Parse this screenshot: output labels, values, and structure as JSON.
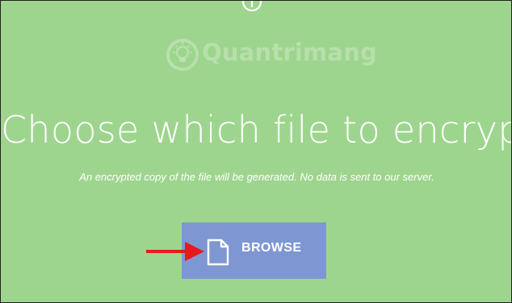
{
  "header": {
    "icon": "info-icon"
  },
  "watermark": {
    "logo_icon": "lightbulb-icon",
    "text": "Quantrimang"
  },
  "main": {
    "title": "Choose which file to encrypt",
    "subtitle": "An encrypted copy of the file will be generated. No data is sent to our server."
  },
  "browse": {
    "label": "BROWSE",
    "icon": "file-icon"
  },
  "annotation": {
    "icon": "red-arrow-icon",
    "color": "#e31b1b"
  },
  "colors": {
    "background": "#9ed58e",
    "button": "#7e97d3",
    "text": "#ffffff"
  }
}
